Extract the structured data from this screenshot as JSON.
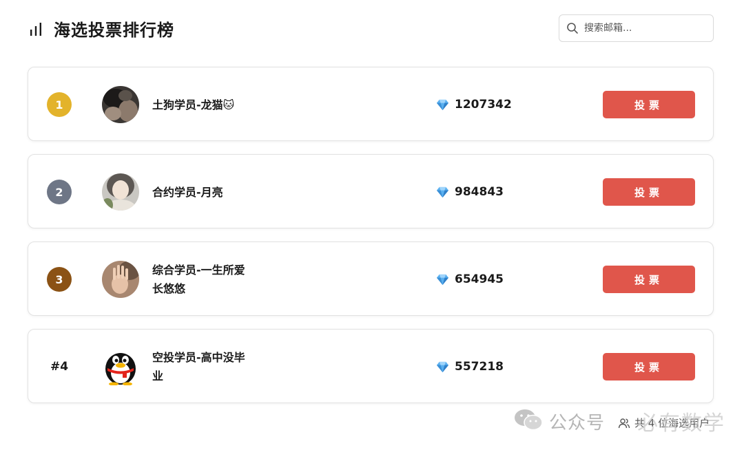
{
  "header": {
    "title": "海选投票排行榜",
    "icon": "bar-chart-icon",
    "search_placeholder": "搜索邮箱..."
  },
  "colors": {
    "gold": "#e3b32b",
    "silver": "#6e7686",
    "bronze": "#8b5215",
    "vote_button": "#e0564b"
  },
  "entries": [
    {
      "rank": "1",
      "name": "土狗学员-龙猫🐱",
      "score": "1207342",
      "vote_label": "投票"
    },
    {
      "rank": "2",
      "name": "合约学员-月亮",
      "score": "984843",
      "vote_label": "投票"
    },
    {
      "rank": "3",
      "name": "综合学员-一生所爱长悠悠",
      "score": "654945",
      "vote_label": "投票"
    },
    {
      "rank": "#4",
      "name": "空投学员-高中没毕业",
      "score": "557218",
      "vote_label": "投票"
    }
  ],
  "footer": {
    "count_text": "共 4 位海选用户",
    "watermark": "公众号",
    "watermark_brand": "必有数学"
  }
}
